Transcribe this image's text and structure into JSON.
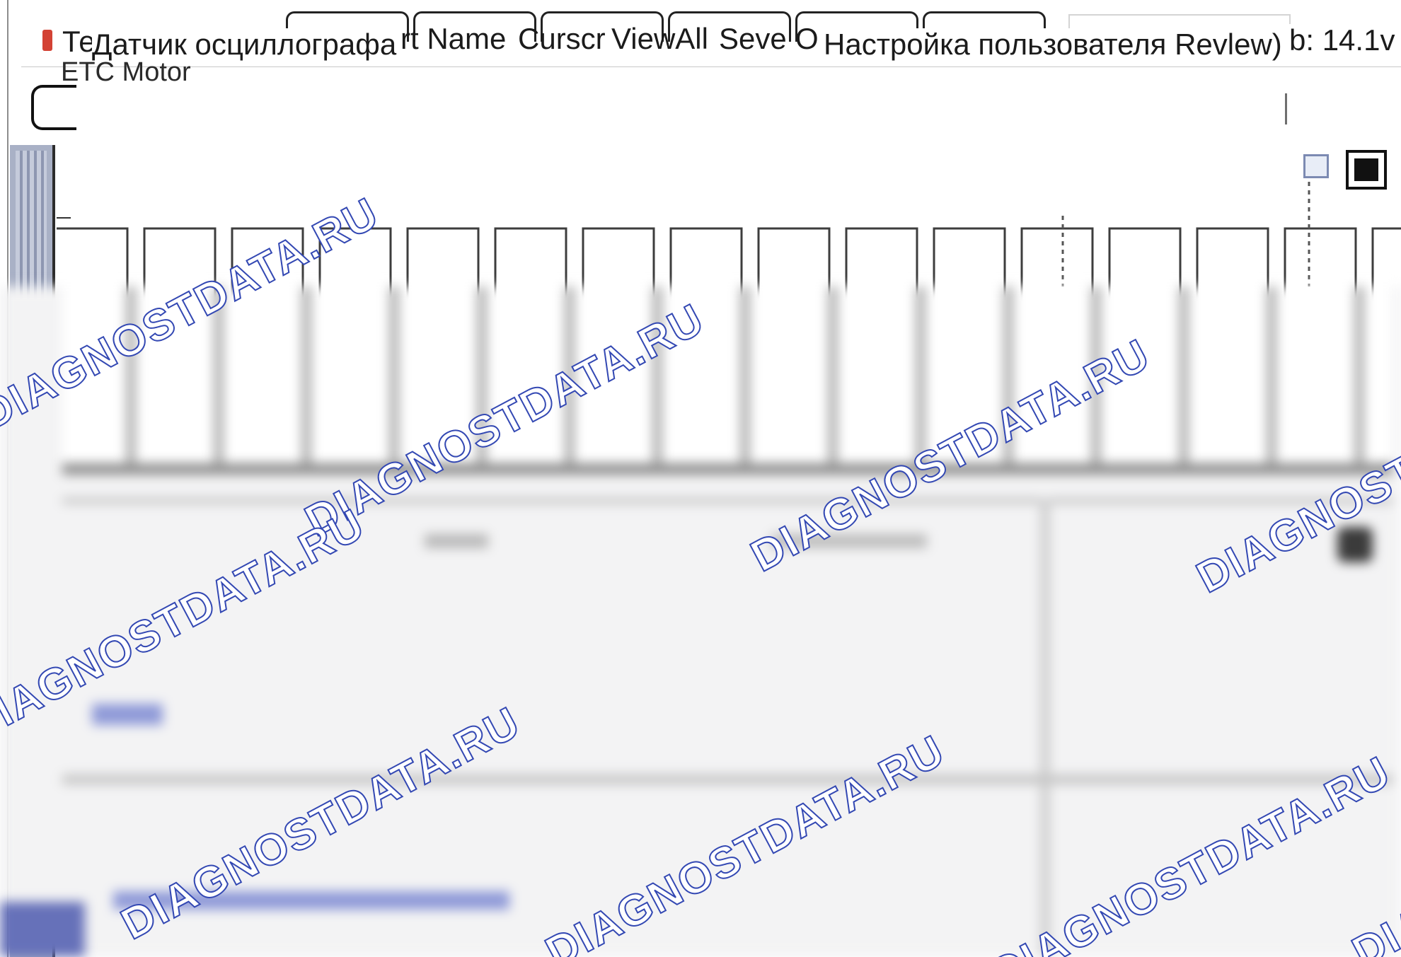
{
  "header": {
    "title_fragment": "Те",
    "overlay_title": "Датчик осциллографа",
    "menu_fragments": {
      "part_name": "rt Name",
      "cursor": "Curscr",
      "view_all": "ViewAll",
      "save": "Seve",
      "other": "O"
    },
    "user_settings": "Настройка пользователя Revlew)",
    "voltage": "b: 14.1v",
    "subtitle": "ETC Motor"
  },
  "toolbar": {
    "cursor_icon": "cursor-toggle-icon",
    "stop_icon": "stop-square-icon"
  },
  "plot": {
    "pulse_count": 16,
    "pulse_level_high": 1,
    "pulse_level_low": 0
  },
  "watermark": {
    "text": "DIAGNOSTDATA.RU",
    "color": "#3348b3"
  }
}
